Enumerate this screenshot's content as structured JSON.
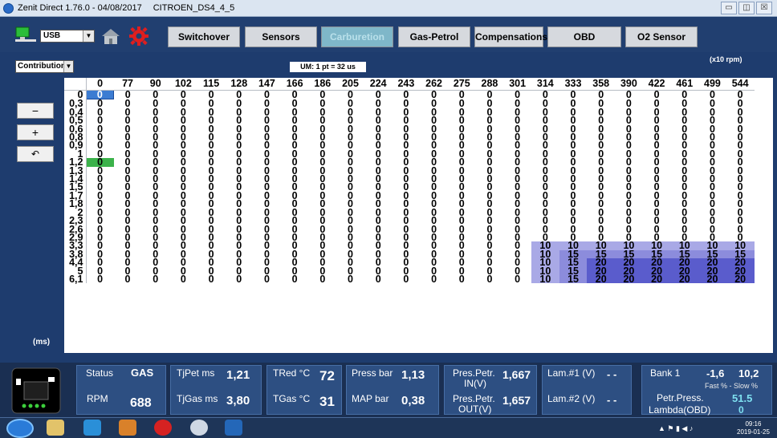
{
  "window": {
    "title_left": "Zenit Direct 1.76.0 - 04/08/2017",
    "title_right": "CITROEN_DS4_4_5",
    "btn_min": "▭",
    "btn_max": "◫",
    "btn_close": "☒"
  },
  "toolbar": {
    "port": "USB",
    "tabs": [
      "Switchover",
      "Sensors",
      "Carburetion",
      "Gas-Petrol",
      "Compensations",
      "OBD",
      "O2 Sensor"
    ],
    "active_tab": "Carburetion"
  },
  "controls": {
    "mode": "Contribution",
    "um": "UM: 1 pt = 32 us",
    "rpm_unit": "(x10 rpm)",
    "ms_unit": "(ms)",
    "minus": "−",
    "plus": "+",
    "undo": "↶"
  },
  "map": {
    "columns": [
      "0",
      "77",
      "90",
      "102",
      "115",
      "128",
      "147",
      "166",
      "186",
      "205",
      "224",
      "243",
      "262",
      "275",
      "288",
      "301",
      "314",
      "333",
      "358",
      "390",
      "422",
      "461",
      "499",
      "544"
    ],
    "rows": [
      "0",
      "0,3",
      "0,4",
      "0,5",
      "0,6",
      "0,8",
      "0,9",
      "1",
      "1,2",
      "1,3",
      "1,4",
      "1,5",
      "1,7",
      "1,8",
      "2",
      "2,3",
      "2,6",
      "2,9",
      "3,3",
      "3,8",
      "4,4",
      "5",
      "6,1"
    ],
    "high_rows": {
      "3,3": [
        "10",
        "10",
        "10",
        "10",
        "10",
        "10",
        "10",
        "10"
      ],
      "3,8": [
        "10",
        "15",
        "15",
        "15",
        "15",
        "15",
        "15",
        "15"
      ],
      "4,4": [
        "10",
        "15",
        "20",
        "20",
        "20",
        "20",
        "20",
        "20"
      ],
      "5": [
        "10",
        "15",
        "20",
        "20",
        "20",
        "20",
        "20",
        "20"
      ],
      "6,1": [
        "10",
        "15",
        "20",
        "20",
        "20",
        "20",
        "20",
        "20"
      ]
    },
    "zero": "0"
  },
  "status": {
    "status_label": "Status",
    "status_value": "GAS",
    "rpm_label": "RPM",
    "rpm_value": "688",
    "tjpet_label": "TjPet ms",
    "tjpet_value": "1,21",
    "tjgas_label": "TjGas ms",
    "tjgas_value": "3,80",
    "tred_label": "TRed °C",
    "tred_value": "72",
    "tgas_label": "TGas °C",
    "tgas_value": "31",
    "press_label": "Press bar",
    "press_value": "1,13",
    "map_label": "MAP bar",
    "map_value": "0,38",
    "prespetr_in_label1": "Pres.Petr.",
    "prespetr_in_label2": "IN(V)",
    "prespetr_in_value": "1,667",
    "prespetr_out_label1": "Pres.Petr.",
    "prespetr_out_label2": "OUT(V)",
    "prespetr_out_value": "1,657",
    "lam1_label": "Lam.#1 (V)",
    "lam1_value": "- -",
    "lam2_label": "Lam.#2 (V)",
    "lam2_value": "- -",
    "bank_label": "Bank 1",
    "bank_fast": "-1,6",
    "bank_slow": "10,2",
    "bank_sub": "Fast % - Slow %",
    "petrpress_label": "Petr.Press.",
    "petrpress_value": "51.5",
    "lambda_obd_label": "Lambda(OBD)",
    "lambda_obd_value": "0"
  },
  "taskbar": {
    "time": "09:16",
    "date": "2019-01-25"
  }
}
